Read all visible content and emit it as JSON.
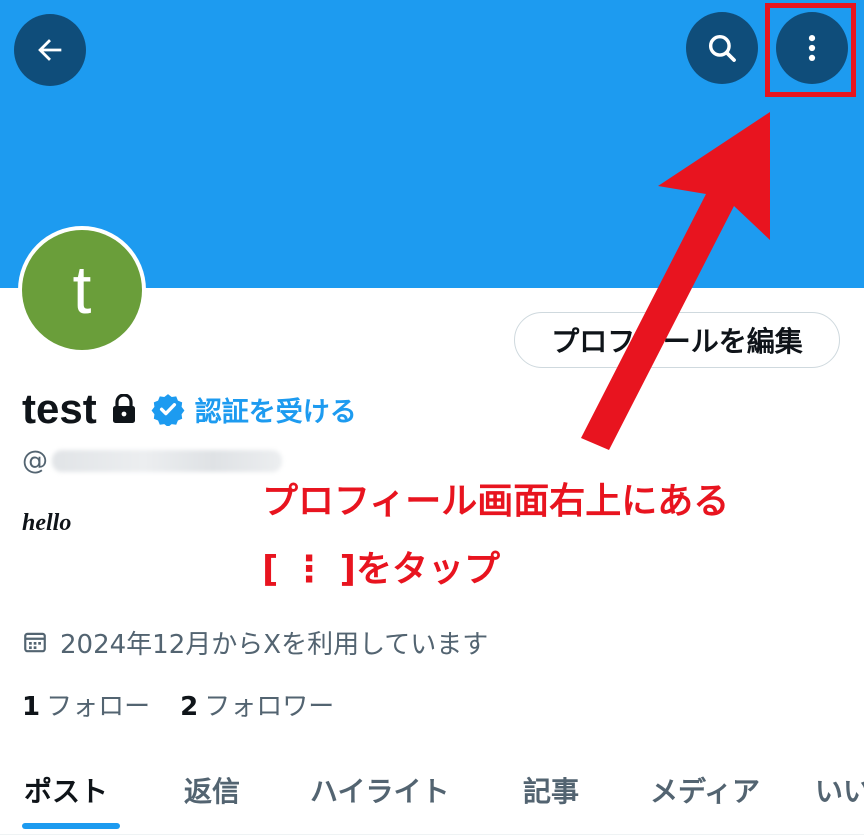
{
  "header": {
    "back_icon": "arrow-left-icon",
    "search_icon": "search-icon",
    "more_icon": "more-vertical-icon",
    "banner_color": "#1d9bf0"
  },
  "profile": {
    "avatar_letter": "t",
    "avatar_color": "#6a9e3a",
    "edit_label": "プロフィールを編集",
    "name": "test",
    "verify_label": "認証を受ける",
    "handle_prefix": "@",
    "bio": "hello",
    "joined": "2024年12月からXを利用しています",
    "following_count": "1",
    "following_label": "フォロー",
    "followers_count": "2",
    "followers_label": "フォロワー"
  },
  "tabs": [
    {
      "label": "ポスト",
      "active": true
    },
    {
      "label": "返信"
    },
    {
      "label": "ハイライト"
    },
    {
      "label": "記事"
    },
    {
      "label": "メディア"
    },
    {
      "label": "いい"
    }
  ],
  "annotation": {
    "line1": "プロフィール画面右上にある",
    "line2": "[ ⋮ ]をタップ",
    "color": "#e8141f"
  }
}
